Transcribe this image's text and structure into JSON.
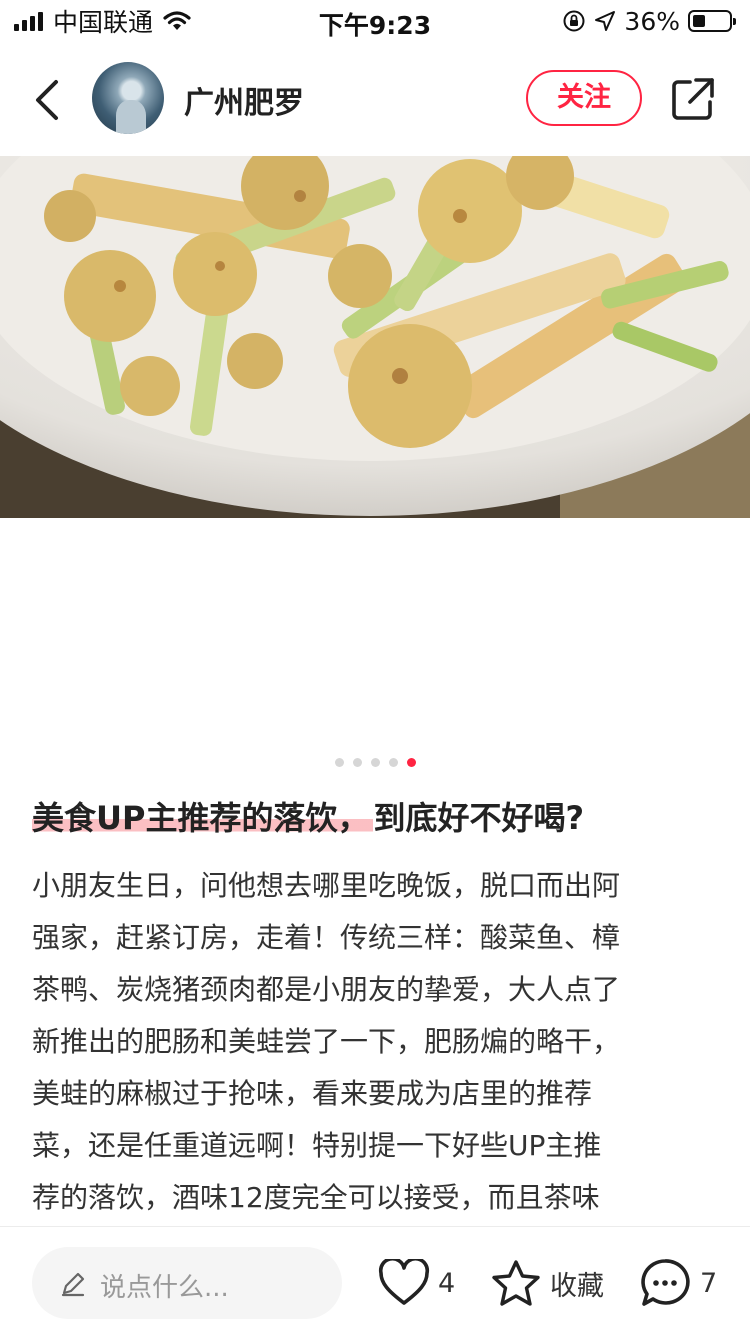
{
  "status_bar": {
    "carrier": "中国联通",
    "time": "下午9:23",
    "battery": "36%",
    "battery_level": 0.36
  },
  "header": {
    "username": "广州肥罗",
    "follow_label": "关注"
  },
  "carousel": {
    "total": 5,
    "active_index": 4
  },
  "post": {
    "title_highlight": "美食UP主推荐的落饮，",
    "title_rest": "到底好不好喝?",
    "body_lines": [
      "小朋友生日，问他想去哪里吃晚饭，脱口而出阿",
      "强家，赶紧订房，走着！传统三样：酸菜鱼、樟",
      "茶鸭、炭烧猪颈肉都是小朋友的挚爱，大人点了",
      "新推出的肥肠和美蛙尝了一下，肥肠煸的略干，",
      "美蛙的麻椒过于抢味，看来要成为店里的推荐",
      "菜，还是任重道远啊！特别提一下好些UP主推",
      "荐的落饮，酒味12度完全可以接受，而且茶味"
    ]
  },
  "bottom_bar": {
    "comment_placeholder": "说点什么...",
    "like_count": "4",
    "favorite_label": "收藏",
    "comment_count": "7"
  },
  "colors": {
    "accent": "#ff2442",
    "highlight": "#f9aab0"
  }
}
